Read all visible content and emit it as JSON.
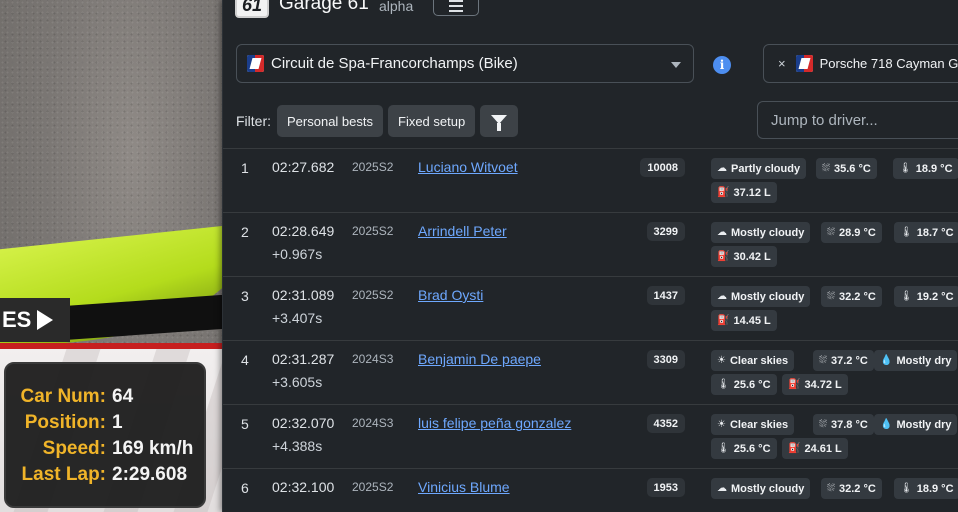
{
  "app": {
    "logo": "61",
    "title": "Garage 61",
    "tag": "alpha"
  },
  "game_hud": {
    "replay_label": "ES",
    "rows": [
      {
        "label": "Car Num:",
        "value": "64"
      },
      {
        "label": "Position:",
        "value": "1"
      },
      {
        "label": "Speed:",
        "value": "169 km/h"
      },
      {
        "label": "Last Lap:",
        "value": "2:29.608"
      }
    ]
  },
  "track_select": {
    "value": "Circuit de Spa-Francorchamps (Bike)"
  },
  "car_filter": {
    "remove": "×",
    "value": "Porsche 718 Cayman G"
  },
  "filters": {
    "label": "Filter:",
    "personal_bests": "Personal bests",
    "fixed_setup": "Fixed setup"
  },
  "jump": {
    "placeholder": "Jump to driver..."
  },
  "laps": [
    {
      "pos": "1",
      "time": "02:27.682",
      "gap": "",
      "season": "2025S2",
      "driver": "Luciano Witvoet",
      "irating": "10008",
      "chips": [
        "Partly cloudy",
        "35.6 °C",
        "18.9 °C",
        "37.12 L"
      ]
    },
    {
      "pos": "2",
      "time": "02:28.649",
      "gap": "+0.967s",
      "season": "2025S2",
      "driver": "Arrindell Peter",
      "irating": "3299",
      "chips": [
        "Mostly cloudy",
        "28.9 °C",
        "18.7 °C",
        "30.42 L"
      ]
    },
    {
      "pos": "3",
      "time": "02:31.089",
      "gap": "+3.407s",
      "season": "2025S2",
      "driver": "Brad Oysti",
      "irating": "1437",
      "chips": [
        "Mostly cloudy",
        "32.2 °C",
        "19.2 °C",
        "14.45 L"
      ]
    },
    {
      "pos": "4",
      "time": "02:31.287",
      "gap": "+3.605s",
      "season": "2024S3",
      "driver": "Benjamin De paepe",
      "irating": "3309",
      "chips": [
        "Clear skies",
        "37.2 °C",
        "Mostly dry",
        "25.6 °C",
        "34.72 L"
      ]
    },
    {
      "pos": "5",
      "time": "02:32.070",
      "gap": "+4.388s",
      "season": "2024S3",
      "driver": "luis felipe peña gonzalez",
      "irating": "4352",
      "chips": [
        "Clear skies",
        "37.8 °C",
        "Mostly dry",
        "25.6 °C",
        "24.61 L"
      ]
    },
    {
      "pos": "6",
      "time": "02:32.100",
      "gap": "",
      "season": "2025S2",
      "driver": "Vinicius Blume",
      "irating": "1953",
      "chips": [
        "Mostly cloudy",
        "32.2 °C",
        "18.9 °C"
      ]
    }
  ]
}
